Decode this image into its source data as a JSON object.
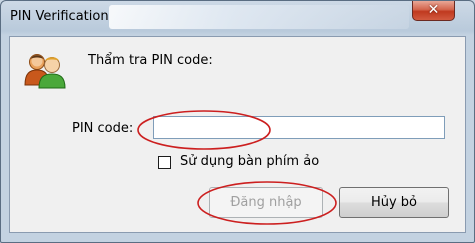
{
  "window": {
    "title": "PIN Verification",
    "close_glyph": "✕"
  },
  "main": {
    "heading": "Thẩm tra PIN code:",
    "icon": "users-icon",
    "pin_label": "PIN code:",
    "pin_value": "",
    "pin_placeholder": "",
    "virtual_keyboard_label": "Sử dụng bàn phím ảo",
    "virtual_keyboard_checked": false
  },
  "buttons": {
    "login_label": "Đăng nhập",
    "login_enabled": false,
    "cancel_label": "Hủy bỏ"
  },
  "annotations": {
    "color": "#cc1f1f",
    "items": [
      "pin-input-highlight",
      "login-button-highlight"
    ]
  }
}
